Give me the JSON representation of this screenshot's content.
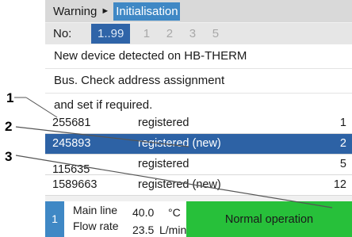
{
  "titlebar": {
    "crumb": "Warning",
    "arrow": "►",
    "active": "Initialisation"
  },
  "numbar": {
    "label": "No:",
    "selected": "1..99",
    "numbers": [
      "1",
      "2",
      "3",
      "5"
    ]
  },
  "message": [
    "New device detected on HB-THERM",
    "Bus. Check address assignment",
    "and set if required."
  ],
  "devices": [
    {
      "address": "255681",
      "status": "registered",
      "number": "1"
    },
    {
      "address": "245893",
      "status": "registered (new)",
      "number": "2",
      "selected": true
    },
    {
      "address": "115635",
      "status": "registered",
      "number": "5"
    },
    {
      "address": "1589663",
      "status": "registered (new)",
      "number": "12"
    }
  ],
  "status": {
    "badge": "1",
    "row1": {
      "label": "Main line",
      "value": "40.0",
      "unit": "°C"
    },
    "row2": {
      "label": "Flow rate",
      "value": "23.5",
      "unit": "L/min"
    },
    "operation": "Normal operation"
  },
  "callouts": [
    "1",
    "2",
    "3"
  ],
  "colors": {
    "accent": "#3f88c5",
    "selection": "#2d62a5",
    "ok": "#27c03a"
  }
}
